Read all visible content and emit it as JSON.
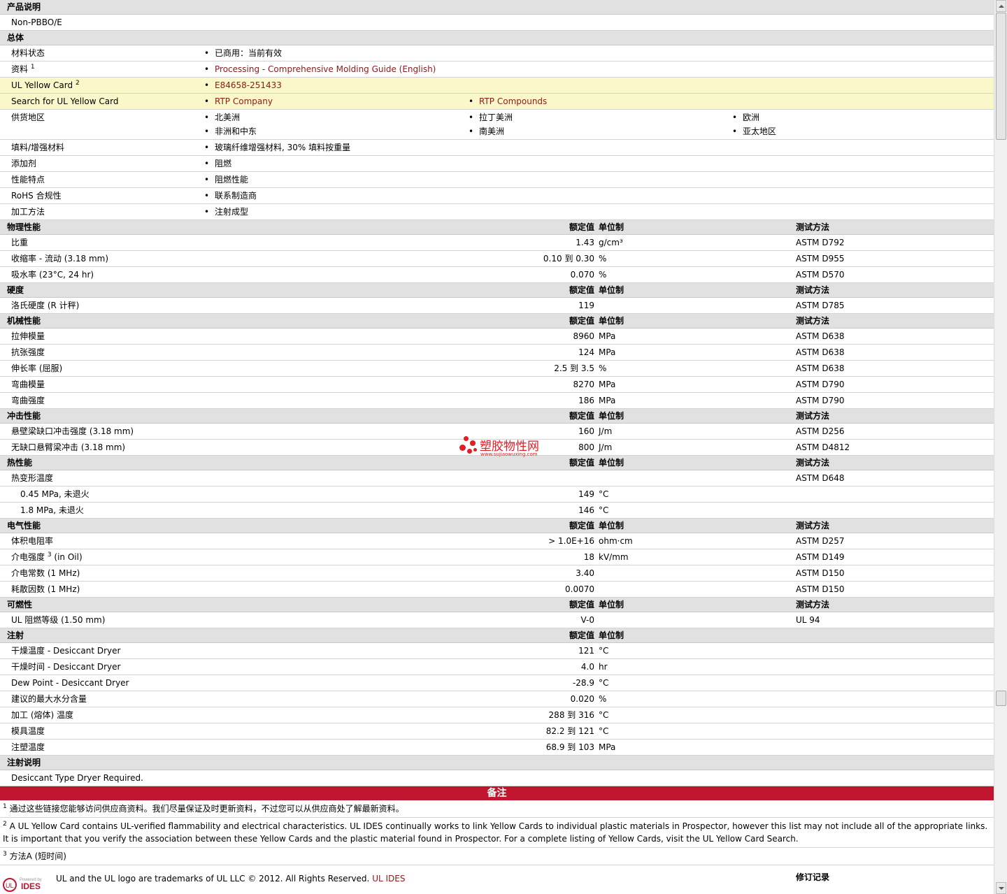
{
  "product_desc": {
    "title": "产品说明",
    "text": "Non-PBBO/E"
  },
  "general": {
    "title": "总体",
    "material_status": {
      "label": "材料状态",
      "value": "已商用：当前有效"
    },
    "docs": {
      "label": "资料",
      "sup": "1",
      "value": "Processing - Comprehensive Molding Guide (English)"
    },
    "yellow_card": {
      "label": "UL Yellow Card",
      "sup": "2",
      "value": "E84658-251433"
    },
    "search_card": {
      "label": "Search for UL Yellow Card",
      "v1": "RTP Company",
      "v2": "RTP Compounds"
    },
    "regions": {
      "label": "供货地区",
      "items": [
        "北美洲",
        "拉丁美洲",
        "欧洲",
        "非洲和中东",
        "南美洲",
        "亚太地区"
      ]
    },
    "filler": {
      "label": "填料/增强材料",
      "value": "玻璃纤维增强材料, 30% 填料按重量"
    },
    "additive": {
      "label": "添加剂",
      "value": "阻燃"
    },
    "features": {
      "label": "性能特点",
      "value": "阻燃性能"
    },
    "rohs": {
      "label": "RoHS 合规性",
      "value": "联系制造商"
    },
    "processing": {
      "label": "加工方法",
      "value": "注射成型"
    }
  },
  "headers": {
    "nominal": "额定值",
    "unit": "单位制",
    "test": "测试方法"
  },
  "physical": {
    "title": "物理性能",
    "rows": [
      {
        "label": "比重",
        "value": "1.43",
        "unit": "g/cm³",
        "test": "ASTM D792"
      },
      {
        "label": "收缩率 - 流动 (3.18 mm)",
        "value": "0.10 到  0.30",
        "unit": "%",
        "test": "ASTM D955"
      },
      {
        "label": "吸水率 (23°C, 24 hr)",
        "value": "0.070",
        "unit": "%",
        "test": "ASTM D570"
      }
    ]
  },
  "hardness": {
    "title": "硬度",
    "rows": [
      {
        "label": "洛氏硬度 (R 计秤)",
        "value": "119",
        "unit": "",
        "test": "ASTM D785"
      }
    ]
  },
  "mechanical": {
    "title": "机械性能",
    "rows": [
      {
        "label": "拉伸模量",
        "value": "8960",
        "unit": "MPa",
        "test": "ASTM D638"
      },
      {
        "label": "抗张强度",
        "value": "124",
        "unit": "MPa",
        "test": "ASTM D638"
      },
      {
        "label": "伸长率 (屈服)",
        "value": "2.5 到  3.5",
        "unit": "%",
        "test": "ASTM D638"
      },
      {
        "label": "弯曲模量",
        "value": "8270",
        "unit": "MPa",
        "test": "ASTM D790"
      },
      {
        "label": "弯曲强度",
        "value": "186",
        "unit": "MPa",
        "test": "ASTM D790"
      }
    ]
  },
  "impact": {
    "title": "冲击性能",
    "rows": [
      {
        "label": "悬壁梁缺口冲击强度 (3.18 mm)",
        "value": "160",
        "unit": "J/m",
        "test": "ASTM D256"
      },
      {
        "label": "无缺口悬臂梁冲击 (3.18 mm)",
        "value": "800",
        "unit": "J/m",
        "test": "ASTM D4812"
      }
    ]
  },
  "thermal": {
    "title": "热性能",
    "rows": [
      {
        "label": "热变形温度",
        "value": "",
        "unit": "",
        "test": "ASTM D648"
      },
      {
        "label": "0.45 MPa, 未退火",
        "value": "149",
        "unit": "°C",
        "test": ""
      },
      {
        "label": "1.8 MPa, 未退火",
        "value": "146",
        "unit": "°C",
        "test": ""
      }
    ]
  },
  "electrical": {
    "title": "电气性能",
    "rows": [
      {
        "label": "体积电阻率",
        "value": "> 1.0E+16",
        "unit": "ohm·cm",
        "test": "ASTM D257"
      },
      {
        "label": "介电强度",
        "sup": "3",
        "suffix": " (in Oil)",
        "value": "18",
        "unit": "kV/mm",
        "test": "ASTM D149"
      },
      {
        "label": "介电常数 (1 MHz)",
        "value": "3.40",
        "unit": "",
        "test": "ASTM D150"
      },
      {
        "label": "耗散因数 (1 MHz)",
        "value": "0.0070",
        "unit": "",
        "test": "ASTM D150"
      }
    ]
  },
  "flammability": {
    "title": "可燃性",
    "rows": [
      {
        "label": "UL 阻燃等级 (1.50 mm)",
        "value": "V-0",
        "unit": "",
        "test": "UL 94"
      }
    ]
  },
  "injection": {
    "title": "注射",
    "rows": [
      {
        "label": "干燥温度 - Desiccant Dryer",
        "value": "121",
        "unit": "°C"
      },
      {
        "label": "干燥时间 - Desiccant Dryer",
        "value": "4.0",
        "unit": "hr"
      },
      {
        "label": "Dew Point - Desiccant Dryer",
        "value": "-28.9",
        "unit": "°C"
      },
      {
        "label": "建议的最大水分含量",
        "value": "0.020",
        "unit": "%"
      },
      {
        "label": "加工 (熔体) 温度",
        "value": "288 到  316",
        "unit": "°C"
      },
      {
        "label": "模具温度",
        "value": "82.2 到  121",
        "unit": "°C"
      },
      {
        "label": "注塑温度",
        "value": "68.9 到  103",
        "unit": "MPa"
      }
    ]
  },
  "injection_notes": {
    "title": "注射说明",
    "text": "Desiccant Type Dryer Required."
  },
  "notes": {
    "title": "备注",
    "items": [
      {
        "sup": "1",
        "text": "通过这些链接您能够访问供应商资料。我们尽量保证及时更新资料，不过您可以从供应商处了解最新资料。"
      },
      {
        "sup": "2",
        "text": "A UL Yellow Card contains UL-verified flammability and electrical characteristics. UL IDES continually works to link Yellow Cards to individual plastic materials in Prospector, however this list may not include all of the appropriate links. It is important that you verify the association between these Yellow Cards and the plastic material found in Prospector. For a complete listing of Yellow Cards, visit the UL Yellow Card Search."
      },
      {
        "sup": "3",
        "text": "方法A (短时间)"
      }
    ]
  },
  "footer": {
    "powered": "Powered by",
    "brand": "IDES",
    "text": "UL and the UL logo are trademarks of UL LLC © 2012. All Rights Reserved.",
    "link": "UL IDES",
    "revision": "修订记录"
  },
  "watermark": {
    "title": "塑胶物性网",
    "url": "www.sujiaowuxing.com"
  },
  "colors": {
    "notes_bar": "#c0152f",
    "link": "#8b1a1a",
    "yellow_row": "#faf8c8",
    "section": "#e1e1e1"
  }
}
